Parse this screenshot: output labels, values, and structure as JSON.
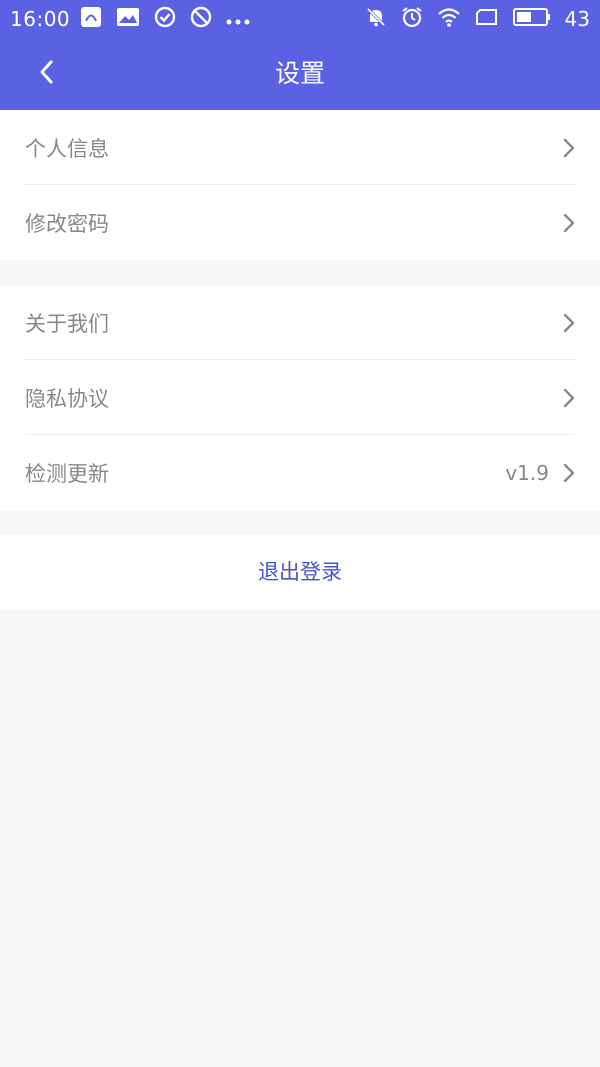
{
  "status_bar": {
    "time": "16:00",
    "battery": "43",
    "left_icons": [
      "app-notification-icon",
      "photo-icon",
      "check-circle-icon",
      "block-icon",
      "more-dots-icon"
    ],
    "right_icons": [
      "mute-bell-icon",
      "alarm-icon",
      "wifi-icon",
      "sim-icon",
      "battery-icon"
    ]
  },
  "header": {
    "title": "设置",
    "back_icon": "chevron-left-icon"
  },
  "groups": [
    {
      "items": [
        {
          "label": "个人信息"
        },
        {
          "label": "修改密码"
        }
      ]
    },
    {
      "items": [
        {
          "label": "关于我们"
        },
        {
          "label": "隐私协议"
        },
        {
          "label": "检测更新",
          "value": "v1.9"
        }
      ]
    }
  ],
  "logout": {
    "label": "退出登录"
  },
  "colors": {
    "primary": "#5b61e3",
    "logout_text": "#4a55c9",
    "label_text": "#888888",
    "background": "#f7f7f7"
  }
}
